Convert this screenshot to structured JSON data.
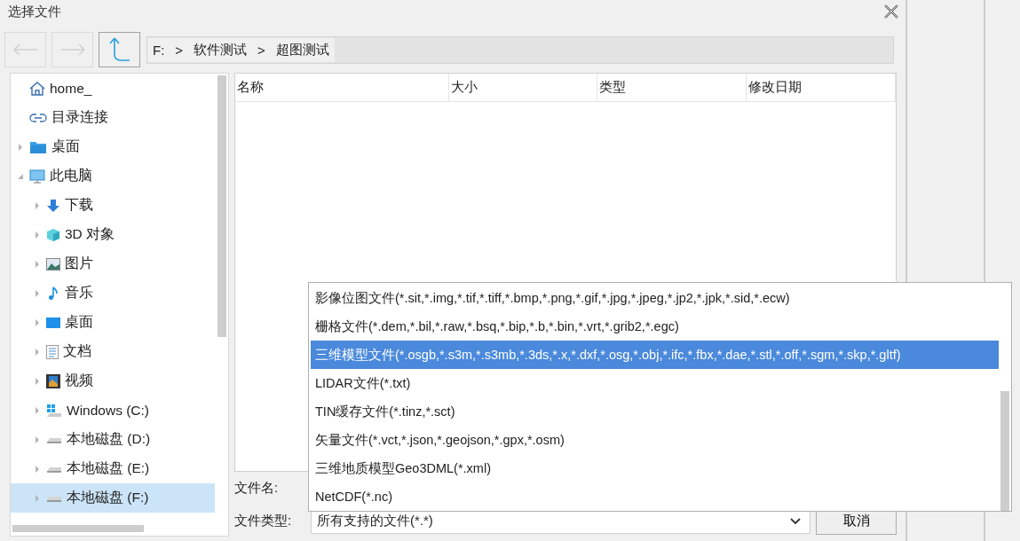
{
  "window": {
    "title": "选择文件"
  },
  "breadcrumb": [
    "F:",
    "软件测试",
    "超图测试"
  ],
  "breadcrumb_separator": ">",
  "tree": [
    {
      "label": "home_",
      "kind": "home",
      "selected": false
    },
    {
      "label": "目录连接",
      "kind": "link",
      "selected": false
    },
    {
      "label": "桌面",
      "kind": "folder",
      "selected": false,
      "expanded": false
    },
    {
      "label": "此电脑",
      "kind": "computer",
      "selected": false,
      "expanded": true,
      "children": [
        {
          "label": "下载",
          "kind": "download",
          "selected": false,
          "expanded": false
        },
        {
          "label": "3D 对象",
          "kind": "cube",
          "selected": false,
          "expanded": false
        },
        {
          "label": "图片",
          "kind": "pictures",
          "selected": false,
          "expanded": false
        },
        {
          "label": "音乐",
          "kind": "music",
          "selected": false,
          "expanded": false
        },
        {
          "label": "桌面",
          "kind": "desktop",
          "selected": false,
          "expanded": false
        },
        {
          "label": "文档",
          "kind": "documents",
          "selected": false,
          "expanded": false
        },
        {
          "label": "视频",
          "kind": "videos",
          "selected": false,
          "expanded": false
        },
        {
          "label": "Windows (C:)",
          "kind": "system-drive",
          "selected": false,
          "expanded": false
        },
        {
          "label": "本地磁盘 (D:)",
          "kind": "drive",
          "selected": false,
          "expanded": false
        },
        {
          "label": "本地磁盘 (E:)",
          "kind": "drive",
          "selected": false,
          "expanded": false
        },
        {
          "label": "本地磁盘 (F:)",
          "kind": "drive",
          "selected": true,
          "expanded": false
        }
      ]
    }
  ],
  "table": {
    "columns": [
      "名称",
      "大小",
      "类型",
      "修改日期"
    ]
  },
  "file_name": {
    "label": "文件名:"
  },
  "file_type": {
    "label": "文件类型:",
    "value": "所有支持的文件(*.*)",
    "expanded": true,
    "options": [
      {
        "label": "影像位图文件(*.sit,*.img,*.tif,*.tiff,*.bmp,*.png,*.gif,*.jpg,*.jpeg,*.jp2,*.jpk,*.sid,*.ecw)",
        "selected": false
      },
      {
        "label": "栅格文件(*.dem,*.bil,*.raw,*.bsq,*.bip,*.b,*.bin,*.vrt,*.grib2,*.egc)",
        "selected": false
      },
      {
        "label": "三维模型文件(*.osgb,*.s3m,*.s3mb,*.3ds,*.x,*.dxf,*.osg,*.obj,*.ifc,*.fbx,*.dae,*.stl,*.off,*.sgm,*.skp,*.gltf)",
        "selected": true
      },
      {
        "label": "LIDAR文件(*.txt)",
        "selected": false
      },
      {
        "label": "TIN缓存文件(*.tinz,*.sct)",
        "selected": false
      },
      {
        "label": "矢量文件(*.vct,*.json,*.geojson,*.gpx,*.osm)",
        "selected": false
      },
      {
        "label": "三维地质模型Geo3DML(*.xml)",
        "selected": false
      },
      {
        "label": "NetCDF(*.nc)",
        "selected": false
      }
    ]
  },
  "buttons": {
    "cancel": "取消"
  }
}
